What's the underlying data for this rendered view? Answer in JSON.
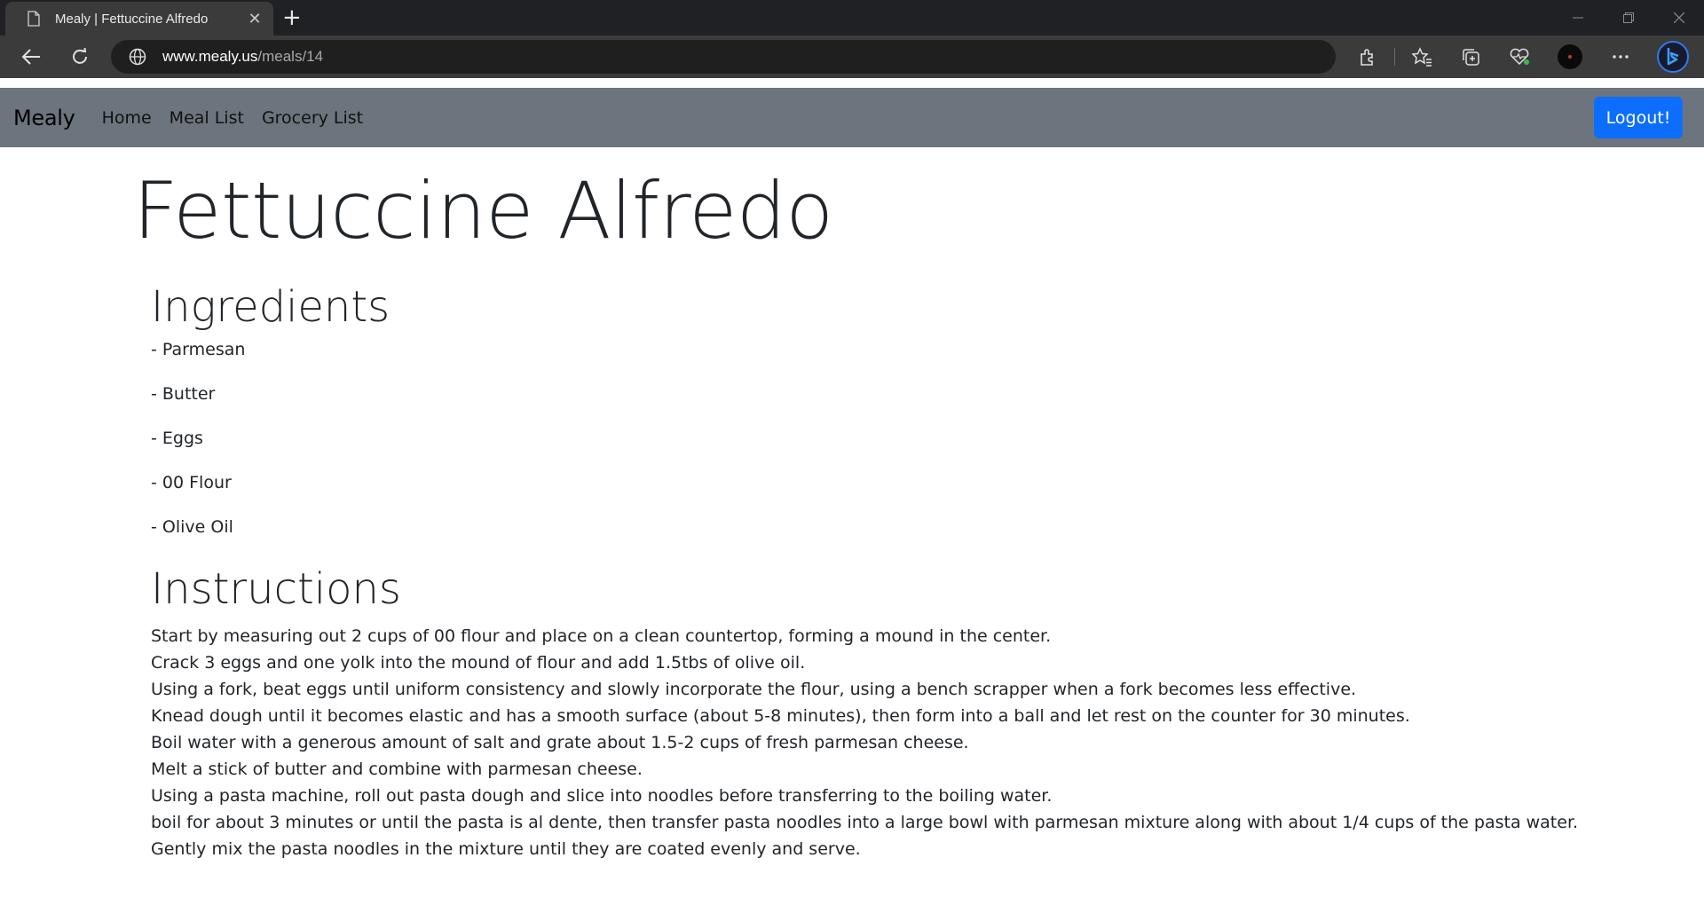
{
  "browser": {
    "tab_title": "Mealy | Fettuccine Alfredo",
    "url_host": "www.mealy.us",
    "url_path": "/meals/14"
  },
  "navbar": {
    "brand": "Mealy",
    "links": [
      "Home",
      "Meal List",
      "Grocery List"
    ],
    "logout_label": "Logout!",
    "background": "#6c757d",
    "button_color": "#0d6efd"
  },
  "meal": {
    "title": "Fettuccine Alfredo",
    "ingredients_heading": "Ingredients",
    "ingredients": [
      "- Parmesan",
      "- Butter",
      "- Eggs",
      "- 00 Flour",
      "- Olive Oil"
    ],
    "instructions_heading": "Instructions",
    "instructions": [
      "Start by measuring out 2 cups of 00 flour and place on a clean countertop, forming a mound in the center.",
      "Crack 3 eggs and one yolk into the mound of flour and add 1.5tbs of olive oil.",
      "Using a fork, beat eggs until uniform consistency and slowly incorporate the flour, using a bench scrapper when a fork becomes less effective.",
      "Knead dough until it becomes elastic and has a smooth surface (about 5-8 minutes), then form into a ball and let rest on the counter for 30 minutes.",
      "Boil water with a generous amount of salt and grate about 1.5-2 cups of fresh parmesan cheese.",
      "Melt a stick of butter and combine with parmesan cheese.",
      "Using a pasta machine, roll out pasta dough and slice into noodles before transferring to the boiling water.",
      "boil for about 3 minutes or until the pasta is al dente, then transfer pasta noodles into a large bowl with parmesan mixture along with about 1/4 cups of the pasta water.",
      "Gently mix the pasta noodles in the mixture until they are coated evenly and serve."
    ]
  }
}
